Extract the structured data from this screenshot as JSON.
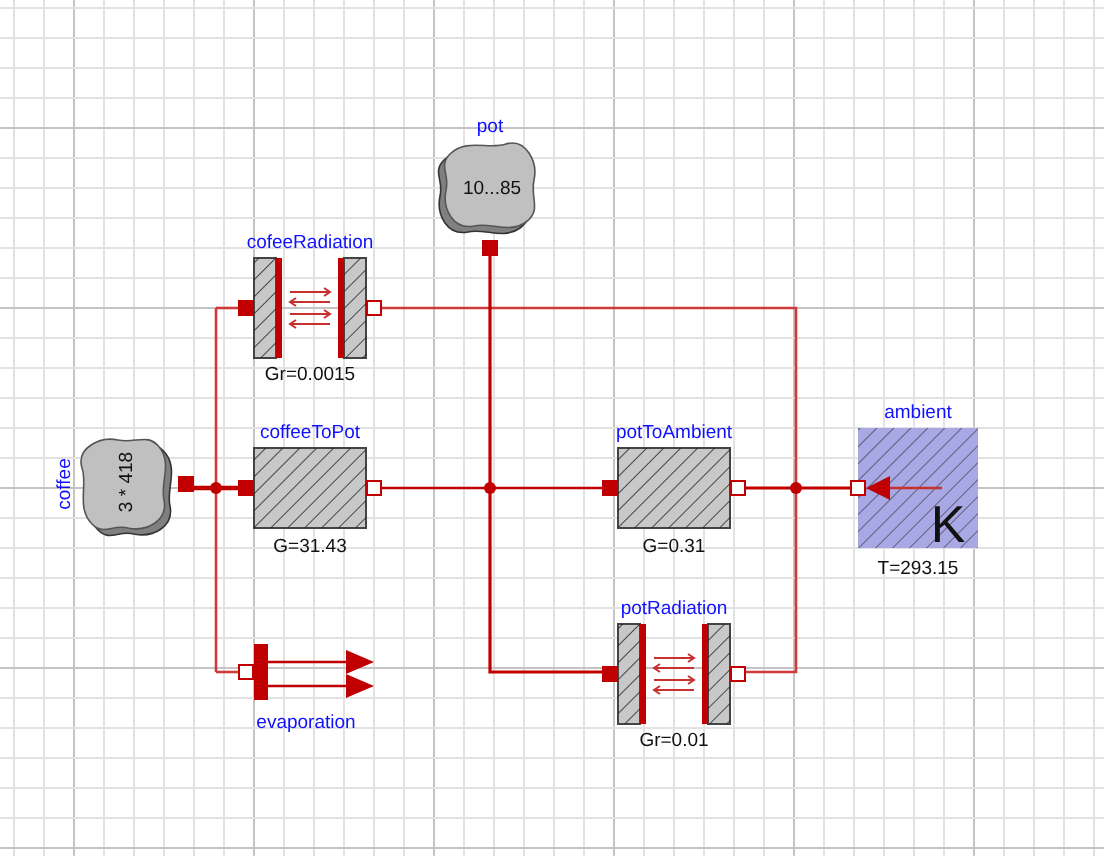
{
  "diagram": {
    "components": [
      {
        "kind": "capacitor",
        "label": "pot",
        "value": "10...85"
      },
      {
        "kind": "radiation",
        "label": "cofeeRadiation",
        "value": "Gr=0.0015"
      },
      {
        "kind": "capacitor",
        "label": "coffee",
        "value": "3 * 418"
      },
      {
        "kind": "conductor",
        "label": "coffeeToPot",
        "value": "G=31.43"
      },
      {
        "kind": "conductor",
        "label": "potToAmbient",
        "value": "G=0.31"
      },
      {
        "kind": "fixed_temperature",
        "label": "ambient",
        "value": "T=293.15",
        "unit": "K"
      },
      {
        "kind": "heat_flow",
        "label": "evaporation"
      },
      {
        "kind": "radiation",
        "label": "potRadiation",
        "value": "Gr=0.01"
      }
    ]
  }
}
